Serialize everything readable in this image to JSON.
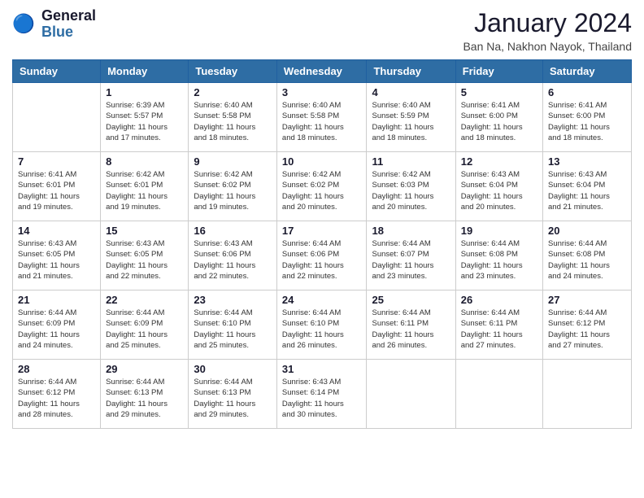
{
  "header": {
    "logo_line1": "General",
    "logo_line2": "Blue",
    "month": "January 2024",
    "location": "Ban Na, Nakhon Nayok, Thailand"
  },
  "weekdays": [
    "Sunday",
    "Monday",
    "Tuesday",
    "Wednesday",
    "Thursday",
    "Friday",
    "Saturday"
  ],
  "weeks": [
    [
      {
        "day": "",
        "info": ""
      },
      {
        "day": "1",
        "info": "Sunrise: 6:39 AM\nSunset: 5:57 PM\nDaylight: 11 hours\nand 17 minutes."
      },
      {
        "day": "2",
        "info": "Sunrise: 6:40 AM\nSunset: 5:58 PM\nDaylight: 11 hours\nand 18 minutes."
      },
      {
        "day": "3",
        "info": "Sunrise: 6:40 AM\nSunset: 5:58 PM\nDaylight: 11 hours\nand 18 minutes."
      },
      {
        "day": "4",
        "info": "Sunrise: 6:40 AM\nSunset: 5:59 PM\nDaylight: 11 hours\nand 18 minutes."
      },
      {
        "day": "5",
        "info": "Sunrise: 6:41 AM\nSunset: 6:00 PM\nDaylight: 11 hours\nand 18 minutes."
      },
      {
        "day": "6",
        "info": "Sunrise: 6:41 AM\nSunset: 6:00 PM\nDaylight: 11 hours\nand 18 minutes."
      }
    ],
    [
      {
        "day": "7",
        "info": "Sunrise: 6:41 AM\nSunset: 6:01 PM\nDaylight: 11 hours\nand 19 minutes."
      },
      {
        "day": "8",
        "info": "Sunrise: 6:42 AM\nSunset: 6:01 PM\nDaylight: 11 hours\nand 19 minutes."
      },
      {
        "day": "9",
        "info": "Sunrise: 6:42 AM\nSunset: 6:02 PM\nDaylight: 11 hours\nand 19 minutes."
      },
      {
        "day": "10",
        "info": "Sunrise: 6:42 AM\nSunset: 6:02 PM\nDaylight: 11 hours\nand 20 minutes."
      },
      {
        "day": "11",
        "info": "Sunrise: 6:42 AM\nSunset: 6:03 PM\nDaylight: 11 hours\nand 20 minutes."
      },
      {
        "day": "12",
        "info": "Sunrise: 6:43 AM\nSunset: 6:04 PM\nDaylight: 11 hours\nand 20 minutes."
      },
      {
        "day": "13",
        "info": "Sunrise: 6:43 AM\nSunset: 6:04 PM\nDaylight: 11 hours\nand 21 minutes."
      }
    ],
    [
      {
        "day": "14",
        "info": "Sunrise: 6:43 AM\nSunset: 6:05 PM\nDaylight: 11 hours\nand 21 minutes."
      },
      {
        "day": "15",
        "info": "Sunrise: 6:43 AM\nSunset: 6:05 PM\nDaylight: 11 hours\nand 22 minutes."
      },
      {
        "day": "16",
        "info": "Sunrise: 6:43 AM\nSunset: 6:06 PM\nDaylight: 11 hours\nand 22 minutes."
      },
      {
        "day": "17",
        "info": "Sunrise: 6:44 AM\nSunset: 6:06 PM\nDaylight: 11 hours\nand 22 minutes."
      },
      {
        "day": "18",
        "info": "Sunrise: 6:44 AM\nSunset: 6:07 PM\nDaylight: 11 hours\nand 23 minutes."
      },
      {
        "day": "19",
        "info": "Sunrise: 6:44 AM\nSunset: 6:08 PM\nDaylight: 11 hours\nand 23 minutes."
      },
      {
        "day": "20",
        "info": "Sunrise: 6:44 AM\nSunset: 6:08 PM\nDaylight: 11 hours\nand 24 minutes."
      }
    ],
    [
      {
        "day": "21",
        "info": "Sunrise: 6:44 AM\nSunset: 6:09 PM\nDaylight: 11 hours\nand 24 minutes."
      },
      {
        "day": "22",
        "info": "Sunrise: 6:44 AM\nSunset: 6:09 PM\nDaylight: 11 hours\nand 25 minutes."
      },
      {
        "day": "23",
        "info": "Sunrise: 6:44 AM\nSunset: 6:10 PM\nDaylight: 11 hours\nand 25 minutes."
      },
      {
        "day": "24",
        "info": "Sunrise: 6:44 AM\nSunset: 6:10 PM\nDaylight: 11 hours\nand 26 minutes."
      },
      {
        "day": "25",
        "info": "Sunrise: 6:44 AM\nSunset: 6:11 PM\nDaylight: 11 hours\nand 26 minutes."
      },
      {
        "day": "26",
        "info": "Sunrise: 6:44 AM\nSunset: 6:11 PM\nDaylight: 11 hours\nand 27 minutes."
      },
      {
        "day": "27",
        "info": "Sunrise: 6:44 AM\nSunset: 6:12 PM\nDaylight: 11 hours\nand 27 minutes."
      }
    ],
    [
      {
        "day": "28",
        "info": "Sunrise: 6:44 AM\nSunset: 6:12 PM\nDaylight: 11 hours\nand 28 minutes."
      },
      {
        "day": "29",
        "info": "Sunrise: 6:44 AM\nSunset: 6:13 PM\nDaylight: 11 hours\nand 29 minutes."
      },
      {
        "day": "30",
        "info": "Sunrise: 6:44 AM\nSunset: 6:13 PM\nDaylight: 11 hours\nand 29 minutes."
      },
      {
        "day": "31",
        "info": "Sunrise: 6:43 AM\nSunset: 6:14 PM\nDaylight: 11 hours\nand 30 minutes."
      },
      {
        "day": "",
        "info": ""
      },
      {
        "day": "",
        "info": ""
      },
      {
        "day": "",
        "info": ""
      }
    ]
  ]
}
